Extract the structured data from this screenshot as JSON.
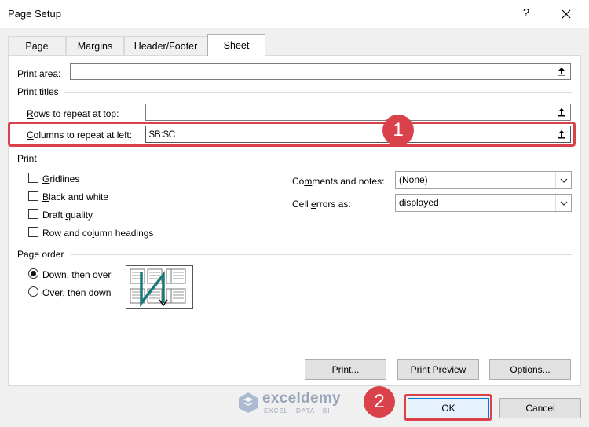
{
  "dialog": {
    "title": "Page Setup",
    "help": "?",
    "tabs": [
      "Page",
      "Margins",
      "Header/Footer",
      "Sheet"
    ],
    "active_tab": "Sheet"
  },
  "sheet": {
    "print_area": {
      "label_pre": "Print ",
      "label_key": "a",
      "label_post": "rea:",
      "value": ""
    },
    "print_titles_header": "Print titles",
    "rows_repeat": {
      "label_key": "R",
      "label_post": "ows to repeat at top:",
      "value": ""
    },
    "cols_repeat": {
      "label_key": "C",
      "label_post": "olumns to repeat at left:",
      "value": "$B:$C"
    },
    "print_header": "Print",
    "options": [
      {
        "pre": "",
        "key": "G",
        "post": "ridlines",
        "checked": false
      },
      {
        "pre": "",
        "key": "B",
        "post": "lack and white",
        "checked": false
      },
      {
        "pre": "Draft ",
        "key": "q",
        "post": "uality",
        "checked": false
      },
      {
        "pre": "Row and co",
        "key": "l",
        "post": "umn headings",
        "checked": false
      }
    ],
    "comments": {
      "pre": "Co",
      "key": "m",
      "post": "ments and notes:",
      "value": "(None)"
    },
    "cell_errors": {
      "pre": "Cell ",
      "key": "e",
      "post": "rrors as:",
      "value": "displayed"
    },
    "page_order_header": "Page order",
    "order_options": [
      {
        "key": "D",
        "post": "own, then over",
        "checked": true
      },
      {
        "pre": "O",
        "key": "v",
        "post": "er, then down",
        "checked": false
      }
    ]
  },
  "buttons": {
    "print": {
      "key": "P",
      "post": "rint..."
    },
    "print_preview": {
      "pre": "Print Previe",
      "key": "w",
      "post": ""
    },
    "options": {
      "key": "O",
      "post": "ptions..."
    },
    "ok": "OK",
    "cancel": "Cancel"
  },
  "annotations": {
    "badge1": "1",
    "badge2": "2",
    "color": "#d9414b"
  },
  "watermark": {
    "name": "exceldemy",
    "sub": "EXCEL · DATA · BI"
  }
}
